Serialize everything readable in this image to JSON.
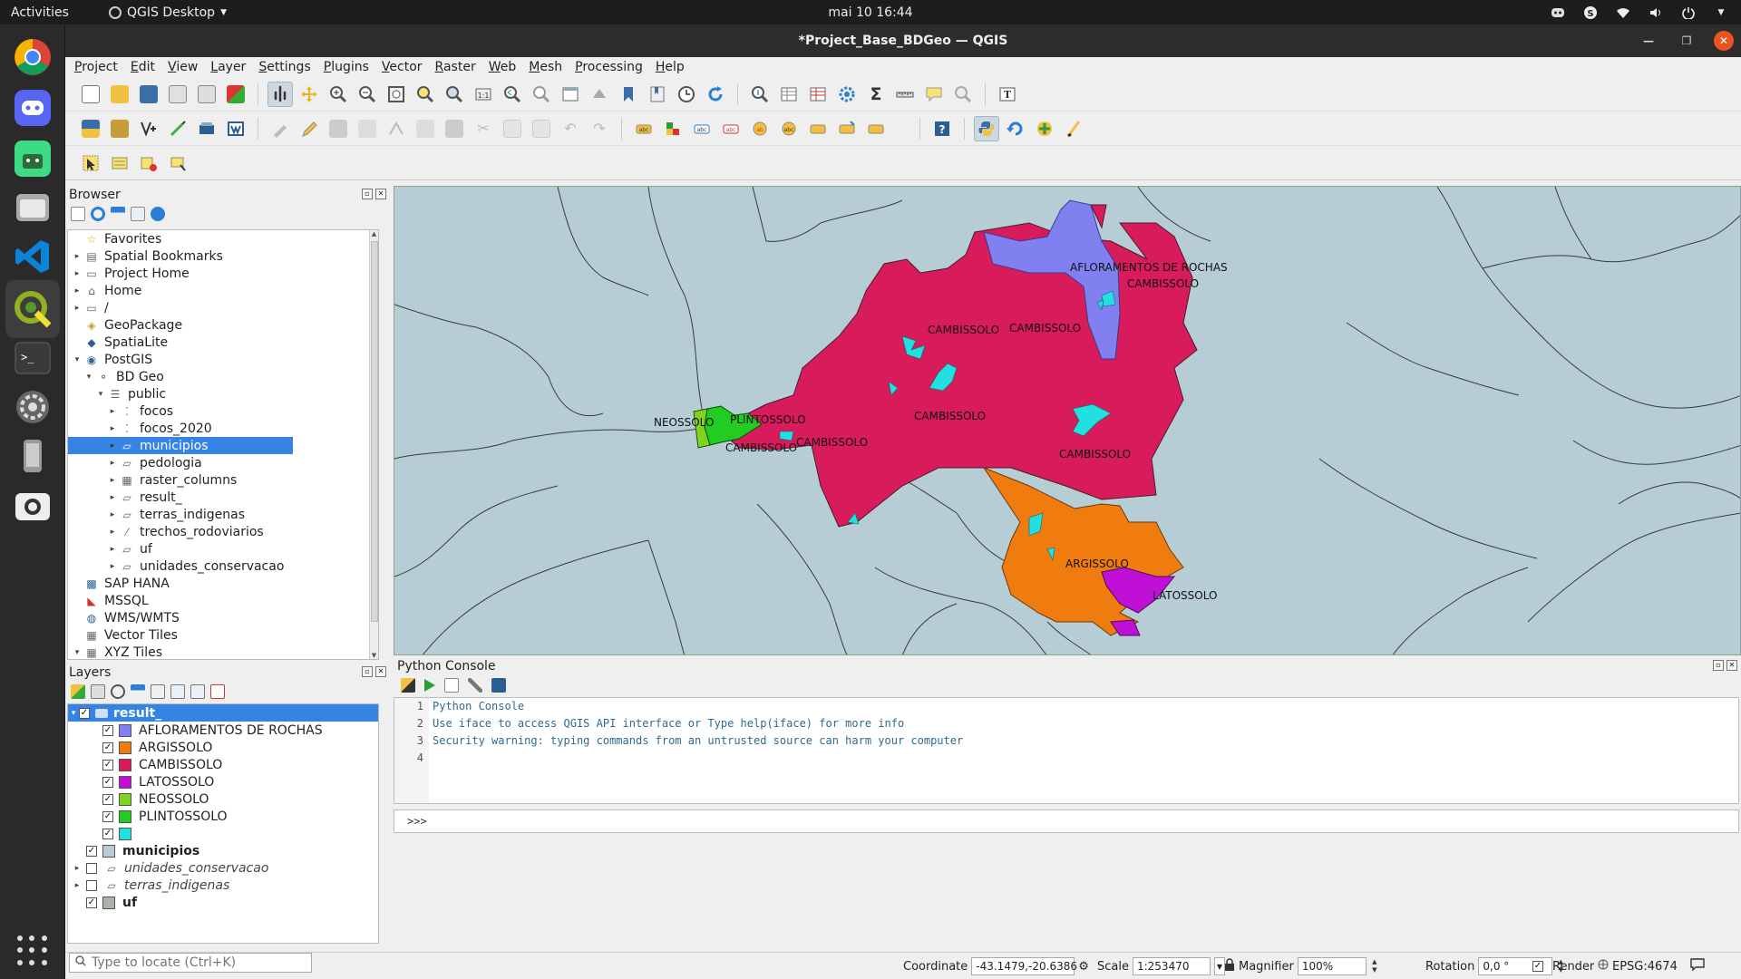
{
  "os": {
    "activities": "Activities",
    "app_name": "QGIS Desktop",
    "clock": "mai 10  16:44"
  },
  "window": {
    "title": "*Project_Base_BDGeo — QGIS"
  },
  "menu": [
    "Project",
    "Edit",
    "View",
    "Layer",
    "Settings",
    "Plugins",
    "Vector",
    "Raster",
    "Web",
    "Mesh",
    "Processing",
    "Help"
  ],
  "browser": {
    "title": "Browser",
    "items": [
      {
        "label": "Favorites",
        "icon": "star-icon",
        "arrow": "",
        "depth": 0
      },
      {
        "label": "Spatial Bookmarks",
        "icon": "bookmark-icon",
        "arrow": "▸",
        "depth": 0
      },
      {
        "label": "Project Home",
        "icon": "folder-icon",
        "arrow": "▸",
        "depth": 0
      },
      {
        "label": "Home",
        "icon": "home-icon",
        "arrow": "▸",
        "depth": 0
      },
      {
        "label": "/",
        "icon": "folder-icon",
        "arrow": "▸",
        "depth": 0
      },
      {
        "label": "GeoPackage",
        "icon": "geopackage-icon",
        "arrow": "",
        "depth": 0
      },
      {
        "label": "SpatiaLite",
        "icon": "spatialite-icon",
        "arrow": "",
        "depth": 0
      },
      {
        "label": "PostGIS",
        "icon": "postgis-elephant-icon",
        "arrow": "▾",
        "depth": 0
      },
      {
        "label": "BD Geo",
        "icon": "connection-icon",
        "arrow": "▾",
        "depth": 1
      },
      {
        "label": "public",
        "icon": "schema-icon",
        "arrow": "▾",
        "depth": 2
      },
      {
        "label": "focos",
        "icon": "point-layer-icon",
        "arrow": "▸",
        "depth": 3
      },
      {
        "label": "focos_2020",
        "icon": "point-layer-icon",
        "arrow": "▸",
        "depth": 3
      },
      {
        "label": "municipios",
        "icon": "polygon-layer-icon",
        "arrow": "▸",
        "depth": 3,
        "selected": true
      },
      {
        "label": "pedologia",
        "icon": "polygon-layer-icon",
        "arrow": "▸",
        "depth": 3
      },
      {
        "label": "raster_columns",
        "icon": "table-icon",
        "arrow": "▸",
        "depth": 3
      },
      {
        "label": "result_",
        "icon": "polygon-layer-icon",
        "arrow": "▸",
        "depth": 3
      },
      {
        "label": "terras_indigenas",
        "icon": "polygon-layer-icon",
        "arrow": "▸",
        "depth": 3
      },
      {
        "label": "trechos_rodoviarios",
        "icon": "line-layer-icon",
        "arrow": "▸",
        "depth": 3
      },
      {
        "label": "uf",
        "icon": "polygon-layer-icon",
        "arrow": "▸",
        "depth": 3
      },
      {
        "label": "unidades_conservacao",
        "icon": "polygon-layer-icon",
        "arrow": "▸",
        "depth": 3
      },
      {
        "label": "SAP HANA",
        "icon": "sap-hana-icon",
        "arrow": "",
        "depth": 0
      },
      {
        "label": "MSSQL",
        "icon": "mssql-icon",
        "arrow": "",
        "depth": 0
      },
      {
        "label": "WMS/WMTS",
        "icon": "globe-icon",
        "arrow": "",
        "depth": 0
      },
      {
        "label": "Vector Tiles",
        "icon": "vector-tiles-icon",
        "arrow": "",
        "depth": 0
      },
      {
        "label": "XYZ Tiles",
        "icon": "xyz-tiles-icon",
        "arrow": "▾",
        "depth": 0
      }
    ]
  },
  "layers": {
    "title": "Layers",
    "group": {
      "label": "result_",
      "checked": true
    },
    "classes": [
      {
        "label": "AFLORAMENTOS DE ROCHAS",
        "color": "#8080f0"
      },
      {
        "label": "ARGISSOLO",
        "color": "#f07c10"
      },
      {
        "label": "CAMBISSOLO",
        "color": "#d81b5a"
      },
      {
        "label": "LATOSSOLO",
        "color": "#c010d8"
      },
      {
        "label": "NEOSSOLO",
        "color": "#7ed321"
      },
      {
        "label": "PLINTOSSOLO",
        "color": "#22cc22"
      },
      {
        "label": "",
        "color": "#22e0e0"
      }
    ],
    "others": [
      {
        "label": "municipios",
        "checked": true,
        "style": "bold",
        "color": "#b7cdd6",
        "arrow": ""
      },
      {
        "label": "unidades_conservacao",
        "checked": false,
        "style": "italic",
        "color": "",
        "arrow": "▸"
      },
      {
        "label": "terras_indigenas",
        "checked": false,
        "style": "italic",
        "color": "",
        "arrow": "▸"
      },
      {
        "label": "uf",
        "checked": true,
        "style": "bold",
        "color": "#aab3aa",
        "arrow": ""
      }
    ]
  },
  "map": {
    "background": "#b7cdd6",
    "labels": [
      "AFLORAMENTOS DE ROCHAS",
      "CAMBISSOLO",
      "CAMBISSOLO",
      "CAMBISSOLO",
      "CAMBISSOLO",
      "CAMBISSOLO",
      "CAMBISSOLO",
      "CAMBISSOLO",
      "NEOSSOLO",
      "PLINTOSSOLO",
      "ARGISSOLO",
      "LATOSSOLO"
    ]
  },
  "python_console": {
    "title": "Python Console",
    "lines": [
      {
        "n": "1",
        "text": "Python Console"
      },
      {
        "n": "2",
        "text": "Use iface to access QGIS API interface or Type help(iface) for more info"
      },
      {
        "n": "3",
        "text": "Security warning: typing commands from an untrusted source can harm your computer"
      },
      {
        "n": "4",
        "text": ""
      }
    ],
    "prompt": ">>>"
  },
  "status": {
    "locate_placeholder": "Type to locate (Ctrl+K)",
    "coordinate_label": "Coordinate",
    "coordinate_value": "-43.1479,-20.6386",
    "scale_label": "Scale",
    "scale_value": "1:253470",
    "magnifier_label": "Magnifier",
    "magnifier_value": "100%",
    "rotation_label": "Rotation",
    "rotation_value": "0,0 °",
    "render_label": "Render",
    "crs": "EPSG:4674"
  }
}
